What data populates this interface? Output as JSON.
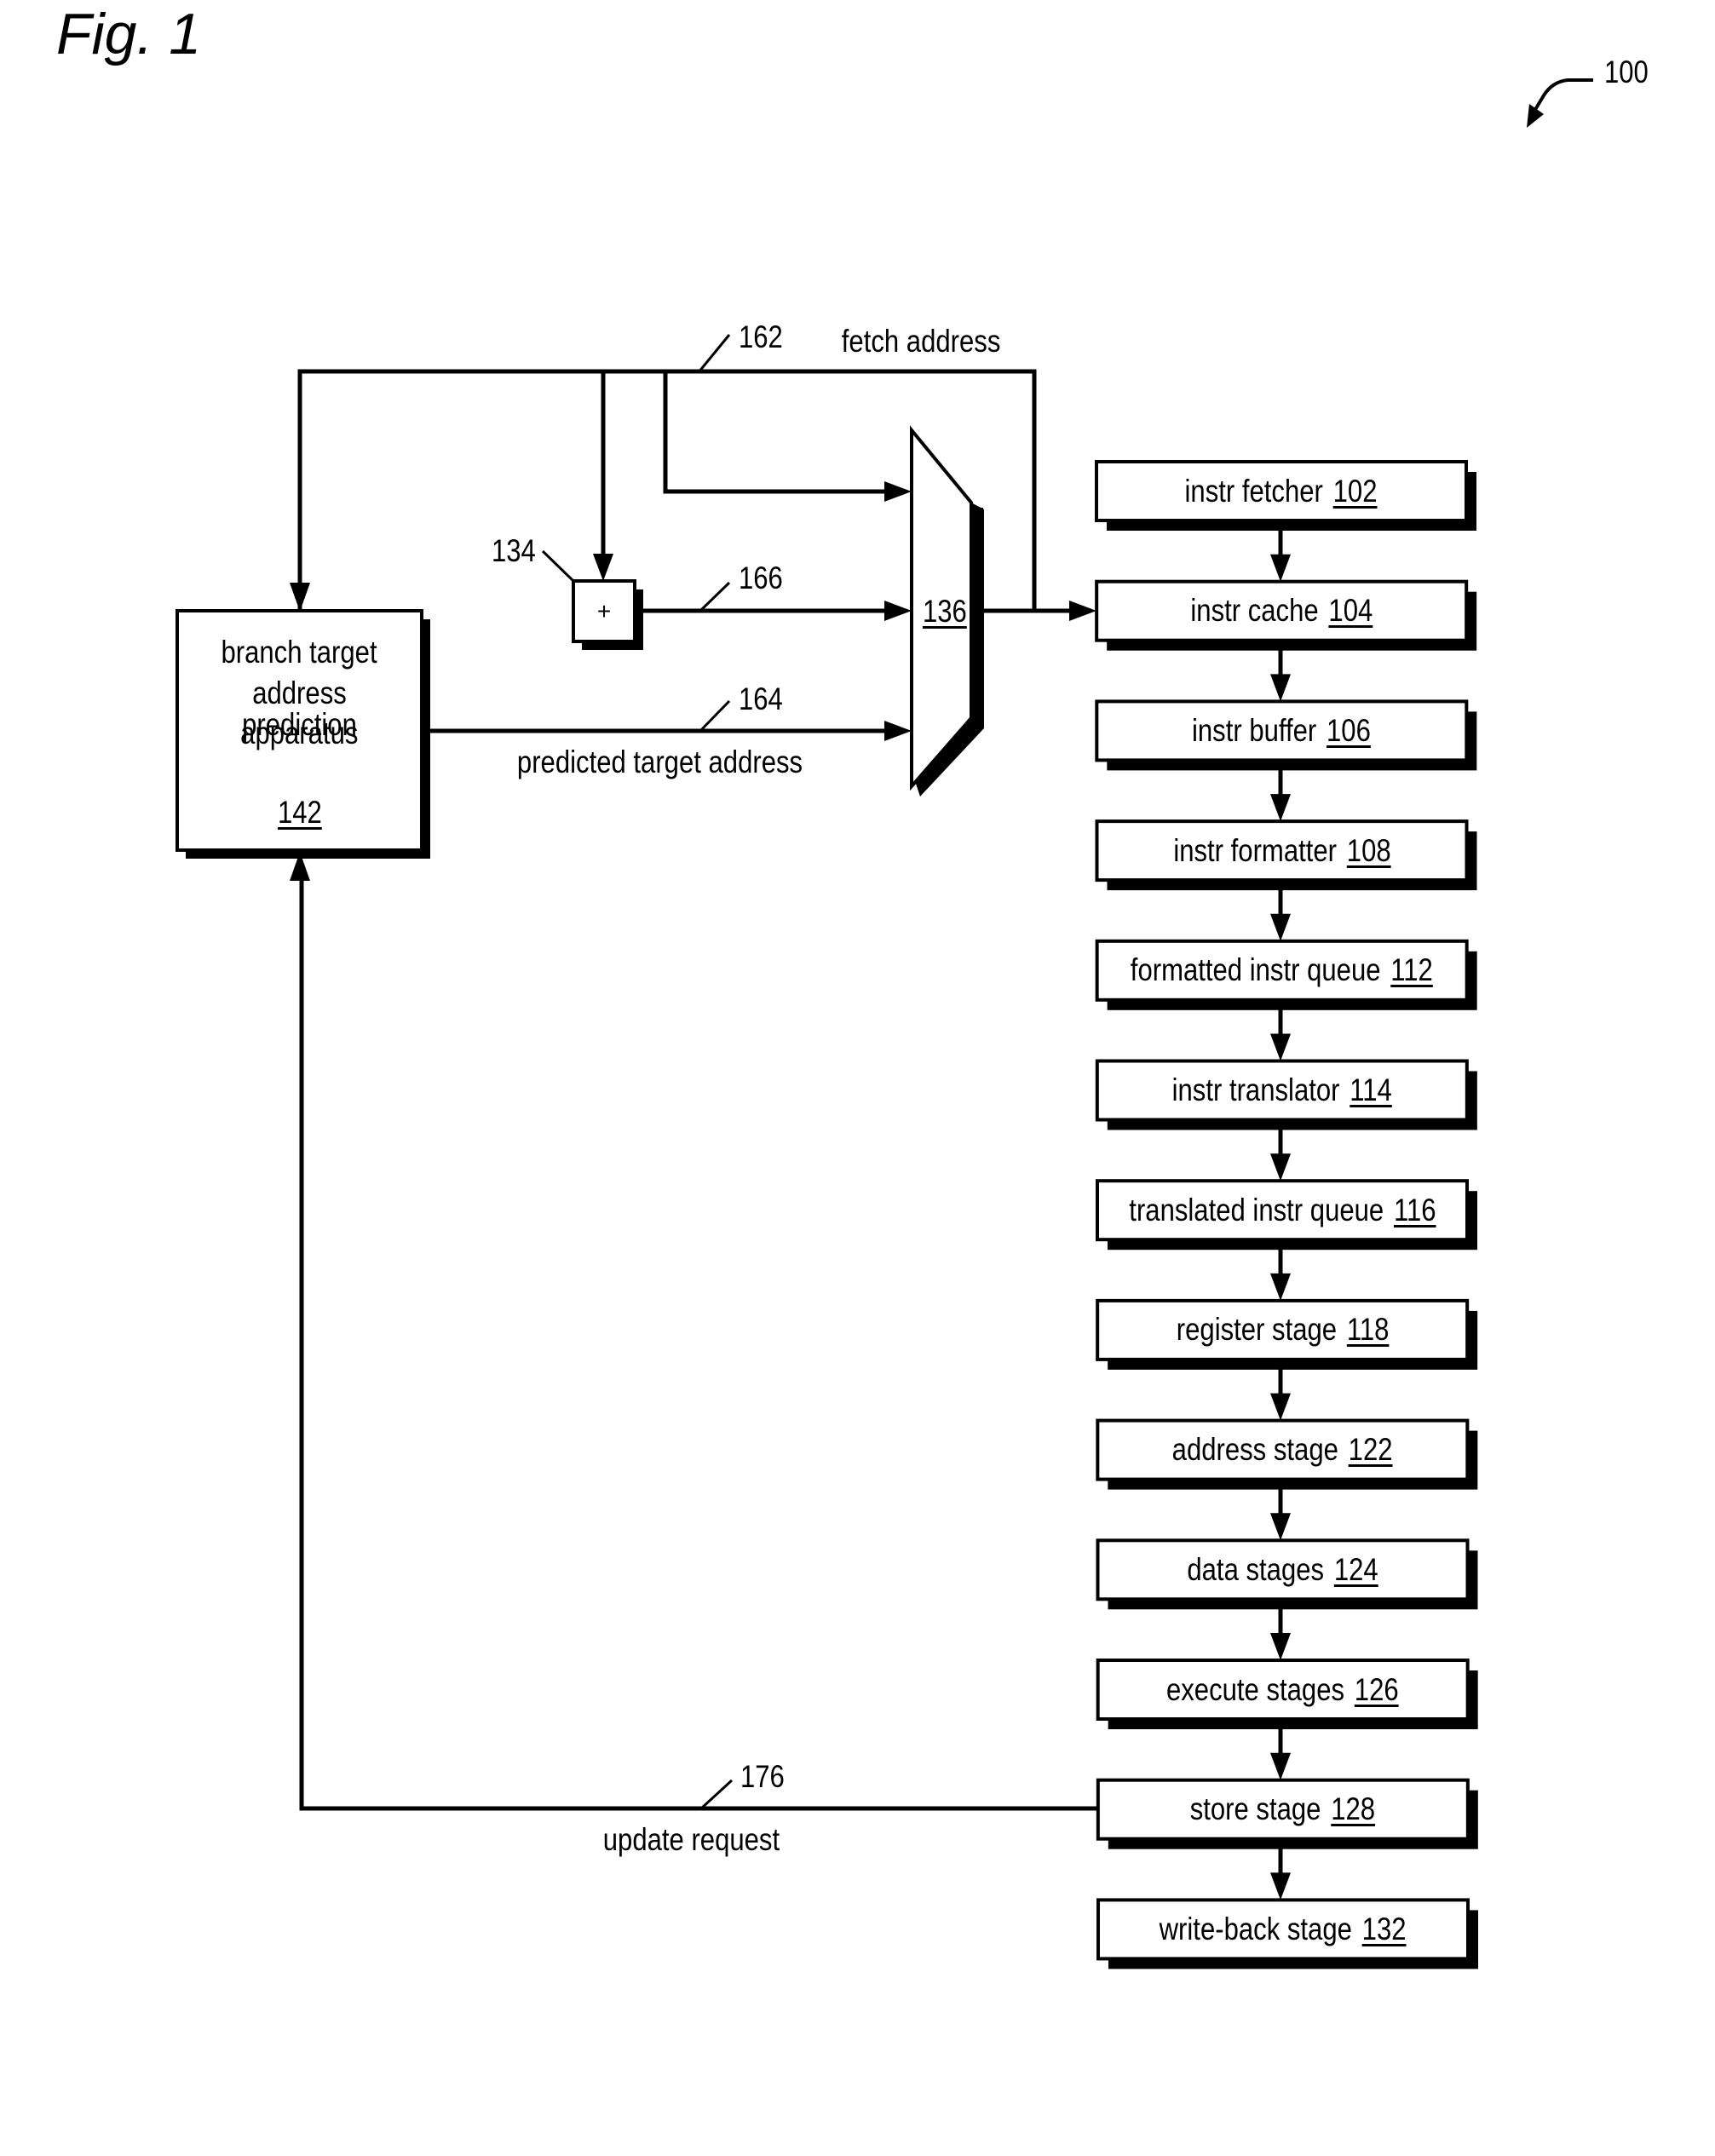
{
  "figure": {
    "title": "Fig. 1",
    "reference": "100"
  },
  "fetch_bus": {
    "label": "fetch address",
    "ref": "162"
  },
  "adder": {
    "symbol": "+",
    "ref": "134",
    "output_ref": "166"
  },
  "mux": {
    "ref": "136"
  },
  "predictor": {
    "lines": [
      "branch target",
      "address prediction",
      "apparatus"
    ],
    "ref": "142",
    "output_label": "predicted target address",
    "output_ref": "164"
  },
  "update": {
    "label": "update request",
    "ref": "176"
  },
  "pipeline": {
    "stages": [
      {
        "name": "instr fetcher",
        "ref": "102"
      },
      {
        "name": "instr cache",
        "ref": "104"
      },
      {
        "name": "instr buffer",
        "ref": "106"
      },
      {
        "name": "instr formatter",
        "ref": "108"
      },
      {
        "name": "formatted instr queue",
        "ref": "112"
      },
      {
        "name": "instr translator",
        "ref": "114"
      },
      {
        "name": "translated instr queue",
        "ref": "116"
      },
      {
        "name": "register stage",
        "ref": "118"
      },
      {
        "name": "address stage",
        "ref": "122"
      },
      {
        "name": "data stages",
        "ref": "124"
      },
      {
        "name": "execute stages",
        "ref": "126"
      },
      {
        "name": "store stage",
        "ref": "128"
      },
      {
        "name": "write-back stage",
        "ref": "132"
      }
    ]
  }
}
